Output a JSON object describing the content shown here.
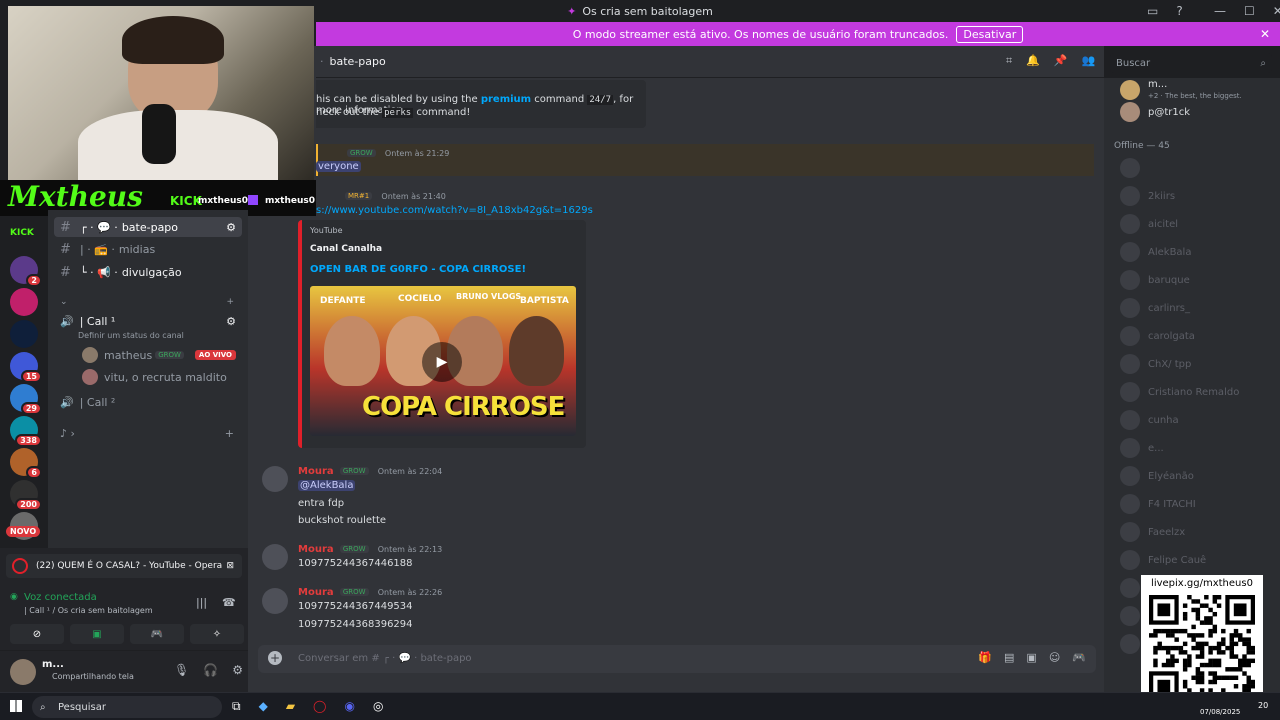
{
  "window": {
    "title": "Os cria sem baitolagem",
    "minimize": "—",
    "maximize": "☐",
    "close": "✕"
  },
  "banner": {
    "text": "O modo streamer está ativo. Os nomes de usuário foram truncados.",
    "button": "Desativar"
  },
  "header": {
    "channel": "bate-papo",
    "search_placeholder": "Buscar"
  },
  "overlay": {
    "brand": "Mxtheus",
    "kick_label": "KICK",
    "kick_user": "mxtheus0",
    "twitch_user": "mxtheus0"
  },
  "rail": [
    {
      "badge": "2",
      "color": "#5b3a8a"
    },
    {
      "badge": "",
      "color": "#c0206a"
    },
    {
      "badge": "",
      "color": "#0f1f3a"
    },
    {
      "badge": "15",
      "color": "#3f58d8"
    },
    {
      "badge": "29",
      "color": "#2f7dd1"
    },
    {
      "badge": "338",
      "color": "#0b8fa5"
    },
    {
      "badge": "6",
      "color": "#b0622a"
    },
    {
      "badge": "200",
      "color": "#303030"
    },
    {
      "badge": "",
      "color": "#6a6a6a"
    }
  ],
  "rail_new": "NOVO",
  "channels": {
    "text": [
      {
        "name": "bate-papo",
        "prefix": "┌ · 💬 ·"
      },
      {
        "name": "midias",
        "prefix": "| · 📻 ·"
      },
      {
        "name": "divulgação",
        "prefix": "└ · 📢 ·"
      }
    ],
    "category": "⌄",
    "call1": "| Call ¹",
    "call1_status": "Definir um status do canal",
    "voice_users": [
      {
        "name": "matheus",
        "tag": "GROW",
        "live": "AO VIVO"
      },
      {
        "name": "vitu, o recruta maldito",
        "tag": "",
        "live": ""
      }
    ],
    "call2": "| Call ²"
  },
  "voice": {
    "app_title": "(22) QUEM É O CASAL? - YouTube - Opera",
    "status": "Voz conectada",
    "location": "| Call ¹ / Os cria sem baitolagem"
  },
  "user": {
    "name": "m...",
    "status": "Compartilhando tela"
  },
  "messages": {
    "bot_line1": "his can be disabled by using the",
    "bot_premium": "premium",
    "bot_line1b": "command",
    "bot_cmd": "24/7",
    "bot_line1c": ", for more information",
    "bot_line2a": "heck out the",
    "bot_cmd2": "perks",
    "bot_line2b": "command!",
    "everyone": {
      "tag": "GROW",
      "time": "Ontem às 21:29",
      "text": "veryone"
    },
    "link": {
      "tag": "MR#1",
      "time": "Ontem às 21:40",
      "url": "s://www.youtube.com/watch?v=8I_A18xb42g&t=1629s"
    },
    "embed": {
      "provider": "YouTube",
      "author": "Canal Canalha",
      "title": "OPEN BAR DE G0RFO - COPA CIRROSE!",
      "thumb_caption": "COPA CIRROSE",
      "thumb_names": [
        "DEFANTE",
        "COCIELO",
        "BRUNO VLOGS",
        "BAPTISTA"
      ]
    },
    "moura": [
      {
        "user": "Moura",
        "tag": "GROW",
        "time": "Ontem às 22:04",
        "lines": [
          "@AlekBala",
          "entra fdp",
          "buckshot roulette"
        ]
      },
      {
        "user": "Moura",
        "tag": "GROW",
        "time": "Ontem às 22:13",
        "lines": [
          "109775244367446188"
        ]
      },
      {
        "user": "Moura",
        "tag": "GROW",
        "time": "Ontem às 22:26",
        "lines": [
          "109775244367449534",
          "109775244368396294"
        ]
      }
    ]
  },
  "composer": {
    "placeholder": "Conversar em #",
    "channel": "bate-papo"
  },
  "members": {
    "top": [
      {
        "name": "m...",
        "sub": "+2 · The best, the biggest."
      },
      {
        "name": "p@tr1ck",
        "sub": ""
      }
    ],
    "offline_header": "Offline — 45",
    "offline": [
      "",
      "2kiirs",
      "aicitel",
      "AlekBala",
      "baruque",
      "carlinrs_",
      "carolgata",
      "ChX/ tpp",
      "Cristiano Remaldo",
      "cunha",
      "e...",
      "Elyéanão",
      "F4 ITACHI",
      "Faeelzx",
      "Felipe Cauê",
      "",
      "",
      ""
    ]
  },
  "qr": {
    "label": "livepix.gg/mxtheus0"
  },
  "taskbar": {
    "search": "Pesquisar",
    "date": "07/08/2025",
    "time": "20"
  },
  "colors": {
    "accent": "#c33adf",
    "brand_green": "#53fc18",
    "link": "#00a8fc",
    "username_red": "#e23c3c"
  }
}
